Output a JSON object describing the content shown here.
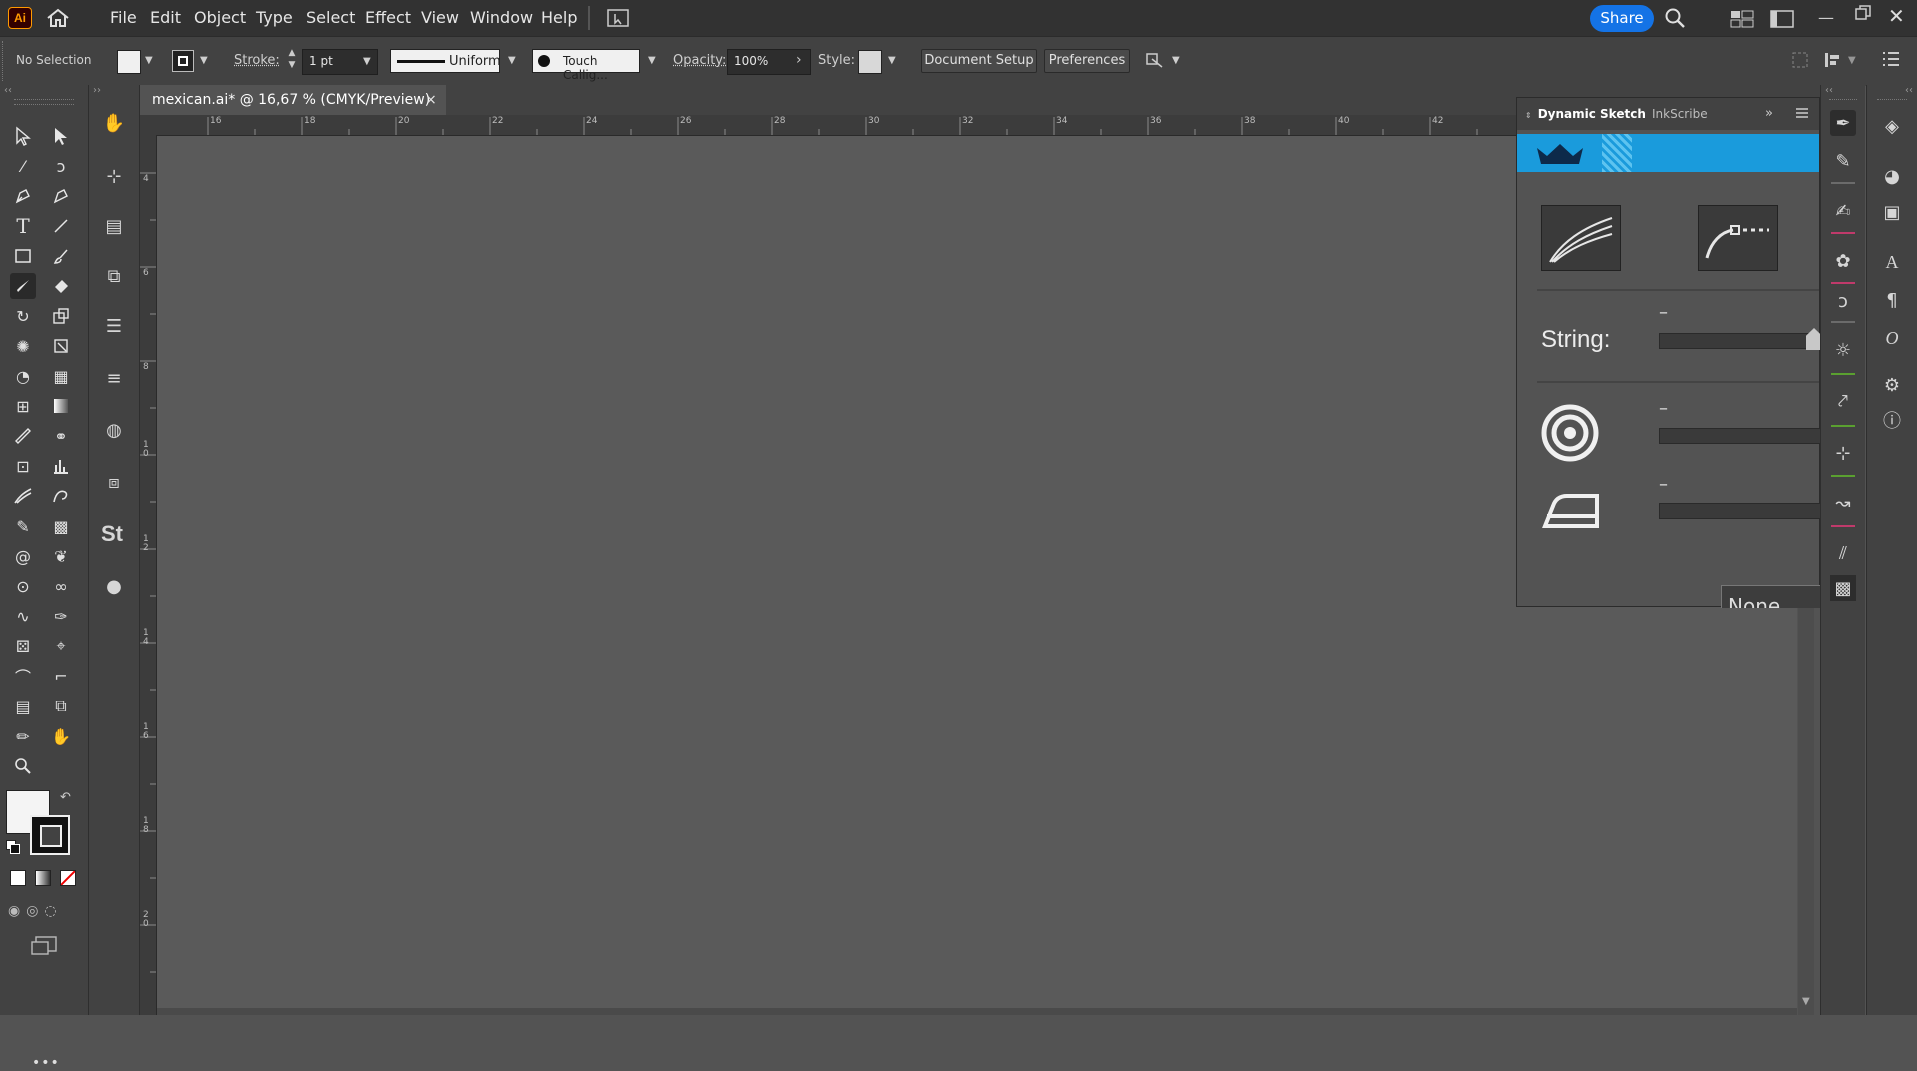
{
  "app": {
    "logo_text": "Ai",
    "menu": [
      "File",
      "Edit",
      "Object",
      "Type",
      "Select",
      "Effect",
      "View",
      "Window",
      "Help"
    ],
    "share_label": "Share",
    "accent_color": "#1473e6"
  },
  "control_bar": {
    "selection_label": "No Selection",
    "stroke_label": "Stroke:",
    "stroke_value": "1 pt",
    "profile_value": "Uniform",
    "brush_value": "Touch Callig...",
    "opacity_label": "Opacity:",
    "opacity_value": "100%",
    "style_label": "Style:",
    "document_setup_label": "Document Setup",
    "preferences_label": "Preferences"
  },
  "document": {
    "tab_title": "mexican.ai* @ 16,67 % (CMYK/Preview)",
    "close_glyph": "×"
  },
  "rulers": {
    "horizontal": [
      "16",
      "18",
      "20",
      "22",
      "24",
      "26",
      "28",
      "30",
      "32",
      "34",
      "36",
      "38",
      "40",
      "42"
    ],
    "vertical": [
      "4",
      "6",
      "8",
      "1 0",
      "1 2",
      "1 4",
      "1 6",
      "1 8",
      "2 0"
    ]
  },
  "panel": {
    "tabs": [
      "Dynamic Sketch",
      "InkScribe"
    ],
    "string_label": "String:",
    "slider_marks": [
      "–",
      "–",
      "–"
    ],
    "bottom_button_text": "None",
    "banner_color": "#1a9bdc"
  },
  "toolbar": {
    "more_label": "•••"
  }
}
